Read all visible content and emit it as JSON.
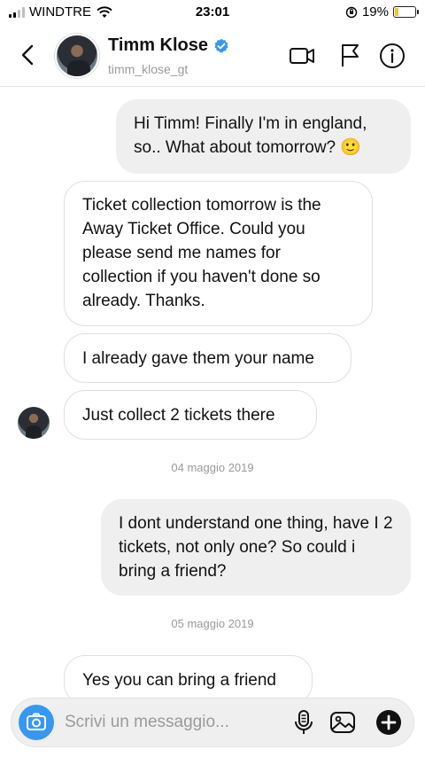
{
  "status_bar": {
    "carrier": "WINDTRE",
    "time": "23:01",
    "battery_percent": "19%",
    "battery_level": 0.19,
    "signal_bars_on": 2,
    "signal_bars_total": 4
  },
  "header": {
    "name": "Timm Klose",
    "username": "timm_klose_gt",
    "icons": [
      "back-chevron-icon",
      "video-call-icon",
      "flag-icon",
      "info-icon",
      "verified-badge-icon"
    ]
  },
  "messages": [
    {
      "direction": "out",
      "text": "Hi Timm! Finally I'm in england, so.. What about tomorrow? 🙂"
    },
    {
      "direction": "in",
      "text": "Ticket collection tomorrow is the Away Ticket Office. Could you please send me names for collection if you haven't done so already. Thanks."
    },
    {
      "direction": "in",
      "text": "I already gave them your name"
    },
    {
      "direction": "in",
      "text": "Just collect 2 tickets there"
    },
    {
      "direction": "out",
      "text": "I dont understand one thing, have I 2 tickets, not only one? So could i bring a friend?"
    },
    {
      "direction": "in",
      "text": "Yes you can bring a friend"
    }
  ],
  "dates": [
    "04 maggio 2019",
    "05 maggio 2019"
  ],
  "composer": {
    "placeholder": "Scrivi un messaggio...",
    "icons": [
      "camera-icon",
      "microphone-icon",
      "gallery-icon",
      "plus-icon"
    ]
  },
  "colors": {
    "accent": "#3897f0",
    "outgoing_bubble": "#efefef",
    "incoming_border": "#e0e0e0",
    "battery_low": "#f4c430"
  }
}
